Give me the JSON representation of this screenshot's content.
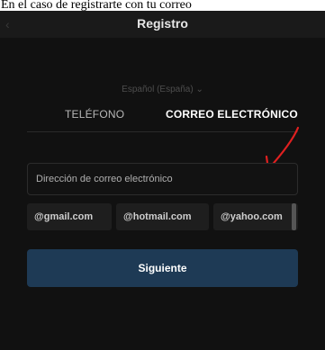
{
  "caption": "En el caso de registrarte con tu correo",
  "header": {
    "title": "Registro",
    "back_icon": "chevron-left-icon"
  },
  "language": {
    "label": "Español (España) ⌄"
  },
  "tabs": [
    {
      "label": "TELÉFONO",
      "selected": false
    },
    {
      "label": "CORREO ELECTRÓNICO",
      "selected": true
    }
  ],
  "email_field": {
    "placeholder": "Dirección de correo electrónico",
    "value": ""
  },
  "domain_suggestions": [
    "@gmail.com",
    "@hotmail.com",
    "@yahoo.com"
  ],
  "next_button": {
    "label": "Siguiente"
  },
  "colors": {
    "background": "#111111",
    "accent": "#1e3a55",
    "annotation": "#e02020"
  }
}
